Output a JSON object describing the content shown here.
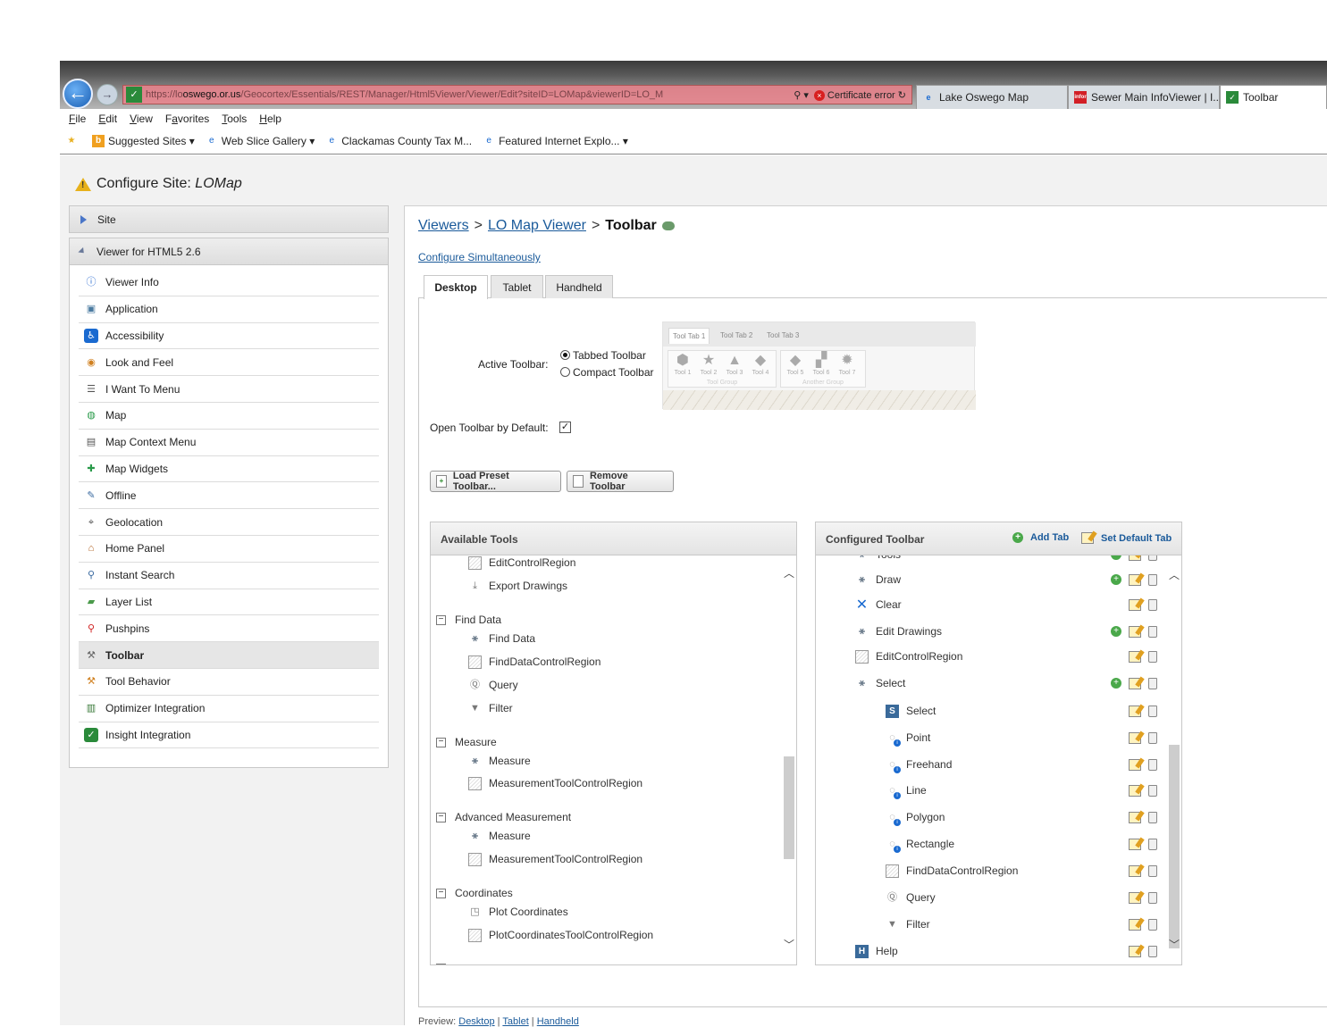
{
  "browser": {
    "url_prefix": "https://lo",
    "url_host": "oswego.or.us",
    "url_suffix": "/Geocortex/Essentials/REST/Manager/Html5Viewer/Viewer/Edit?siteID=LOMap&viewerID=LO_M",
    "certificate_error": "Certificate error",
    "tabs": [
      {
        "label": "Lake Oswego Map"
      },
      {
        "label": "Sewer Main InfoViewer | I..."
      },
      {
        "label": "Toolbar"
      }
    ],
    "menu": [
      "File",
      "Edit",
      "View",
      "Favorites",
      "Tools",
      "Help"
    ],
    "menu_access": [
      "F",
      "E",
      "V",
      "a",
      "T",
      "H"
    ],
    "favorites": [
      {
        "label": "Suggested Sites ▾"
      },
      {
        "label": "Web Slice Gallery ▾"
      },
      {
        "label": "Clackamas County Tax M..."
      },
      {
        "label": "Featured Internet Explo... ▾"
      }
    ]
  },
  "page": {
    "title_prefix": "Configure Site: ",
    "title_site": "LOMap",
    "site_section": "Site",
    "viewer_section": "Viewer for HTML5 2.6",
    "nav_items": [
      {
        "label": "Viewer Info",
        "icon": "info-icon"
      },
      {
        "label": "Application",
        "icon": "application-icon"
      },
      {
        "label": "Accessibility",
        "icon": "accessibility-icon"
      },
      {
        "label": "Look and Feel",
        "icon": "palette-icon"
      },
      {
        "label": "I Want To Menu",
        "icon": "list-icon"
      },
      {
        "label": "Map",
        "icon": "globe-icon"
      },
      {
        "label": "Map Context Menu",
        "icon": "context-menu-icon"
      },
      {
        "label": "Map Widgets",
        "icon": "puzzle-icon"
      },
      {
        "label": "Offline",
        "icon": "offline-icon"
      },
      {
        "label": "Geolocation",
        "icon": "crosshair-icon"
      },
      {
        "label": "Home Panel",
        "icon": "home-icon"
      },
      {
        "label": "Instant Search",
        "icon": "search-icon"
      },
      {
        "label": "Layer List",
        "icon": "layer-icon"
      },
      {
        "label": "Pushpins",
        "icon": "pushpin-icon"
      },
      {
        "label": "Toolbar",
        "icon": "wrench-icon",
        "active": true
      },
      {
        "label": "Tool Behavior",
        "icon": "tool-icon"
      },
      {
        "label": "Optimizer Integration",
        "icon": "bar-chart-icon"
      },
      {
        "label": "Insight Integration",
        "icon": "insight-icon"
      }
    ],
    "breadcrumb": {
      "viewers": "Viewers",
      "sep": ">",
      "viewer": "LO Map Viewer",
      "current": "Toolbar"
    },
    "configure_simultaneously": "Configure Simultaneously",
    "tabs": [
      "Desktop",
      "Tablet",
      "Handheld"
    ],
    "active_toolbar_label": "Active Toolbar:",
    "radio_tabbed": "Tabbed Toolbar",
    "radio_compact": "Compact Toolbar",
    "preview": {
      "tabs": [
        "Tool Tab 1",
        "Tool Tab 2",
        "Tool Tab 3"
      ],
      "group1": [
        "Tool 1",
        "Tool 2",
        "Tool 3",
        "Tool 4"
      ],
      "group1_label": "Tool Group",
      "group2": [
        "Tool 5",
        "Tool 6",
        "Tool 7"
      ],
      "group2_label": "Another Group"
    },
    "open_by_default_label": "Open Toolbar by Default:",
    "open_by_default": true,
    "buttons": {
      "load_preset": "Load Preset Toolbar...",
      "remove": "Remove Toolbar"
    },
    "available_tools": {
      "title": "Available Tools",
      "items": [
        {
          "label": "EditControlRegion",
          "icon": "region"
        },
        {
          "label": "Export Drawings",
          "icon": "export"
        },
        {
          "label": "Find Data",
          "icon": "collapse"
        },
        {
          "label": "Find Data",
          "icon": "tool"
        },
        {
          "label": "FindDataControlRegion",
          "icon": "region"
        },
        {
          "label": "Query",
          "icon": "query"
        },
        {
          "label": "Filter",
          "icon": "filter"
        },
        {
          "label": "Measure",
          "icon": "collapse"
        },
        {
          "label": "Measure",
          "icon": "tool"
        },
        {
          "label": "MeasurementToolControlRegion",
          "icon": "region"
        },
        {
          "label": "Advanced Measurement",
          "icon": "collapse"
        },
        {
          "label": "Measure",
          "icon": "tool"
        },
        {
          "label": "MeasurementToolControlRegion",
          "icon": "region"
        },
        {
          "label": "Coordinates",
          "icon": "collapse"
        },
        {
          "label": "Plot Coordinates",
          "icon": "plot"
        },
        {
          "label": "PlotCoordinatesToolControlRegion",
          "icon": "region"
        }
      ]
    },
    "configured_toolbar": {
      "title": "Configured Toolbar",
      "add_tab": "Add Tab",
      "set_default_tab": "Set Default Tab",
      "items": [
        {
          "label": "Tools",
          "icon": "tool",
          "add": true
        },
        {
          "label": "Draw",
          "icon": "tool",
          "add": true
        },
        {
          "label": "Clear",
          "icon": "x"
        },
        {
          "label": "Edit Drawings",
          "icon": "tool",
          "add": true
        },
        {
          "label": "EditControlRegion",
          "icon": "region"
        },
        {
          "label": "Select",
          "icon": "tool",
          "add": true
        },
        {
          "label": "Select",
          "icon": "s"
        },
        {
          "label": "Point",
          "icon": "info"
        },
        {
          "label": "Freehand",
          "icon": "info"
        },
        {
          "label": "Line",
          "icon": "info"
        },
        {
          "label": "Polygon",
          "icon": "info"
        },
        {
          "label": "Rectangle",
          "icon": "info"
        },
        {
          "label": "FindDataControlRegion",
          "icon": "region"
        },
        {
          "label": "Query",
          "icon": "query"
        },
        {
          "label": "Filter",
          "icon": "filter"
        },
        {
          "label": "Help",
          "icon": "h"
        }
      ]
    },
    "preview_row": {
      "label": "Preview:",
      "links": [
        "Desktop",
        "Tablet",
        "Handheld"
      ]
    }
  }
}
